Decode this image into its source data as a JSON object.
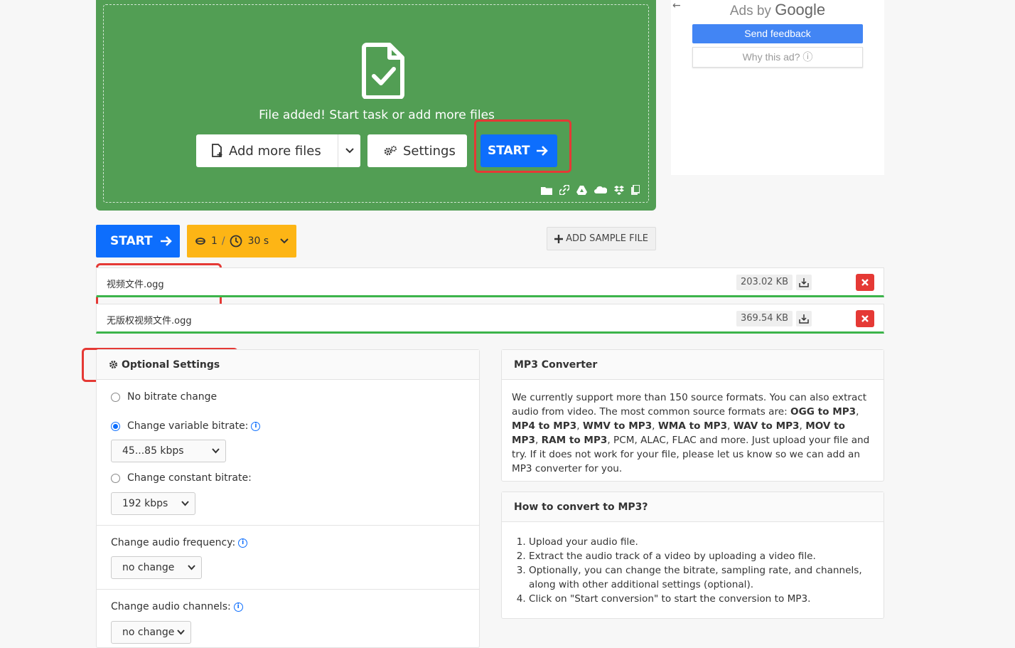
{
  "dropzone": {
    "message": "File added! Start task or add more files",
    "add_more_label": "Add more files",
    "settings_label": "Settings",
    "start_label": "START",
    "cloud_icons": [
      "folder-icon",
      "link-icon",
      "google-drive-icon",
      "onedrive-icon",
      "dropbox-icon",
      "clipboard-icon"
    ]
  },
  "ad": {
    "back_arrow": "←",
    "ads_by": "Ads by",
    "google": "Google",
    "send_feedback": "Send feedback",
    "why_ad": "Why this ad? ⓘ"
  },
  "actions": {
    "start_label": "START",
    "credits": "1",
    "credits_sep": "/",
    "time": "30 s",
    "sample_label": "ADD SAMPLE FILE"
  },
  "files": [
    {
      "name": "视频文件.ogg",
      "size": "203.02 KB"
    },
    {
      "name": "无版权视频文件.ogg",
      "size": "369.54 KB"
    }
  ],
  "optional_settings": {
    "title": "Optional Settings",
    "no_bitrate": "No bitrate change",
    "variable_bitrate": "Change variable bitrate:",
    "variable_value": "45...85 kbps",
    "constant_bitrate": "Change constant bitrate:",
    "constant_value": "192 kbps",
    "frequency_label": "Change audio frequency:",
    "frequency_value": "no change",
    "channels_label": "Change audio channels:",
    "channels_value": "no change"
  },
  "mp3_converter": {
    "title": "MP3 Converter",
    "text_1": "We currently support more than 150 source formats. You can also extract audio from video. The most common source formats are: ",
    "formats": [
      {
        "label": "OGG to MP3",
        "sep": ", "
      },
      {
        "label": "MP4 to MP3",
        "sep": ", "
      },
      {
        "label": "WMV to MP3",
        "sep": ", "
      },
      {
        "label": "WMA to MP3",
        "sep": ", "
      },
      {
        "label": "WAV to MP3",
        "sep": ", "
      },
      {
        "label": "MOV to MP3",
        "sep": ", "
      },
      {
        "label": "RAM to MP3",
        "sep": ", "
      }
    ],
    "text_2": "PCM, ALAC, FLAC and more. Just upload your file and try. If it does not work for your file, please let us know so we can add an MP3 converter for you."
  },
  "how_to": {
    "title": "How to convert to MP3?",
    "steps": [
      "Upload your audio file.",
      "Extract the audio track of a video by uploading a video file.",
      "Optionally, you can change the bitrate, sampling rate, and channels, along with other additional settings (optional).",
      "Click on \"Start conversion\" to start the conversion to MP3."
    ]
  },
  "colors": {
    "dropzone_green": "#529e54",
    "primary_blue": "#0d6efd",
    "credits_yellow": "#fdb515",
    "delete_red": "#e53935",
    "highlight_red": "#e53935",
    "progress_green": "#3cb44b",
    "google_blue": "#4285f4"
  }
}
